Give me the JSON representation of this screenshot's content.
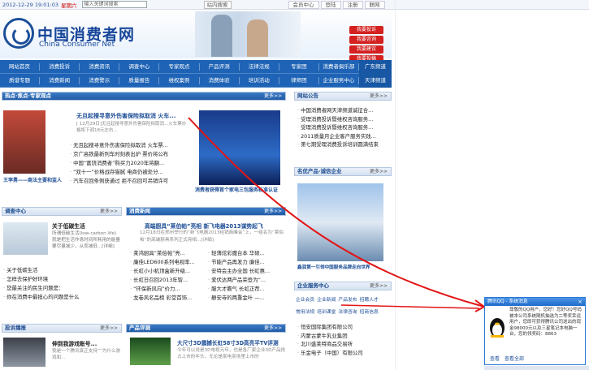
{
  "topbar": {
    "datetime": "2012-12-29 19:01:03",
    "weekday": "星期六",
    "search_placeholder": "输入关键词搜索",
    "mid_buttons": [
      "站内搜索"
    ],
    "links": [
      "会员中心",
      "登陆",
      "注册",
      "联网"
    ]
  },
  "header": {
    "brand_cn": "中国消费者网",
    "brand_en": "China Consumer Net",
    "red_buttons": [
      "我要投诉",
      "我要咨询",
      "我要建议",
      "我要投稿"
    ]
  },
  "nav": {
    "row1": [
      "网站首页",
      "消费投诉",
      "消费资讯",
      "调查中心",
      "专家观点",
      "产品评测",
      "法律法规",
      "专家团",
      "消费者俱乐部"
    ],
    "row2": [
      "质谱专题",
      "消费新闻",
      "消费警示",
      "质量报告",
      "维权案例",
      "消费体验",
      "培训活动",
      "律师团",
      "企业服务中心"
    ],
    "side": [
      "广东频道",
      "天津频道"
    ]
  },
  "hot": {
    "title": "热点·焦点·专家观点",
    "more": "更多>>",
    "lead": "无且起搜寻意外伤害保险拟取消 火车...",
    "lead_sub": "[ 12月29日]无且起搜寻意外伤害保险拟取消...火车票价格将下调18元左右...",
    "items": [
      "无且起搜寻意外伤害保险拟取消 火车票...",
      "京广高铁最新列车时刻表出炉 票价将公布",
      "中国“富饶消费者”购买力2020年将翻...",
      "“双十一”价格战存猫腻 电商仍被处分...",
      "汽车召回条例获通过 拒不召回可吊销许可"
    ],
    "photo_caption": "王李勇——商法主要和监人",
    "center_caption": "消费者获得首个家电三包服务标准认证"
  },
  "notice": {
    "title": "网站公告",
    "more": "更多>>",
    "items": [
      "中国消费者网天津频道诚征合...",
      "受理消费投诉暨维权咨询服务...",
      "受理消费投诉暨维权咨询服务...",
      "2011质量月企业客户服务实践...",
      "第七期受理消费投诉培训圆满结束"
    ]
  },
  "famous": {
    "title": "名优产品·诚信企业",
    "more": "更多>>",
    "caption": "鑫润第一引领中国服务品牌走向世界"
  },
  "survey": {
    "title": "调查中心",
    "more": "更多>>",
    "lead_title": "关于低碳生活",
    "lead_text": "所谓低碳生活(low-carbon life)就是把生活作息时间所耗用的能量要尽量减少，从而减低...[详细]",
    "items": [
      "关于低碳生活",
      "怎样去保护好环境",
      "您最关注的民生问题是：",
      "你在消费中最担心的问题是什么"
    ]
  },
  "consumer_news": {
    "title": "消费新闻",
    "more": "更多>>",
    "lead": "高端厨具“莱伯帕”亮相 新飞电器2013谋势起飞",
    "lead_text": "12月18日在郑州举行的“新飞电器2013经销商峰会”上，一组名为“莱伯帕”的高端厨具系列正式亮相...[详细]",
    "col1": [
      "莱鸿厨具“莱伯帕”亮...",
      "廉佳LED600系列电视率...",
      "长虹小小机顶盒新升级...",
      "长虹日召回2013年智...",
      "“环保新风向”价力...",
      "龙卷风名品榜 彩堂首饰..."
    ],
    "col2": [
      "轻薄炫彩魔台本 华硕...",
      "节能产品再发力 廉佳...",
      "安特会主办全国 长虹惠...",
      "爱伏达两产品荣登为“...",
      "服大才瞻气 长虹正荐...",
      "静安寺的两重金叶 —..."
    ]
  },
  "enterprise": {
    "title": "企业服务中心",
    "more": "更多>>",
    "tabs1": [
      "企业会员",
      "企业新闻",
      "产品发布",
      "招聘人才"
    ],
    "tabs2": [
      "常用法规",
      "培训课堂",
      "法律咨询",
      "招商信息"
    ],
    "items": [
      "恒安国际集团有限公司",
      "内蒙古蒙牛乳业集团",
      "北川盛莱特商品交易所",
      "乐金电子（中国）有限公司"
    ]
  },
  "complaint": {
    "title": "投诉播报",
    "more": "更多>>",
    "lead": "伸到我游戏账号...",
    "lead_text": "我是一个腾讯真正支持“”为什么游戏和..."
  },
  "review": {
    "title": "产品评测",
    "more": "更多>>",
    "lead": "大尺寸3D震撼长虹58寸3D高亮平TV评测",
    "lead_text": "今年可以说是3D电视元年，也是各厂家企业3D产品抢占上市的年头。无论是家电卖场里上市的"
  },
  "popup": {
    "title": "腾讯QQ - 系统消息",
    "close": "×",
    "body": "尊敬的QQ用户，您好！您好QQ号码被本公司系统随机抽选为二等奖幸运用户，您即可获得腾讯公司送出的现金98000元以及三星笔记本电脑一台，您的领奖码：8863",
    "code_label": "您的领奖码：",
    "code": "8863",
    "buttons": [
      "查看",
      "查看全部"
    ]
  },
  "colors": {
    "brand": "#18479a",
    "nav": "#1e63b5",
    "alert": "#d42020",
    "annotation": "#e21414"
  }
}
